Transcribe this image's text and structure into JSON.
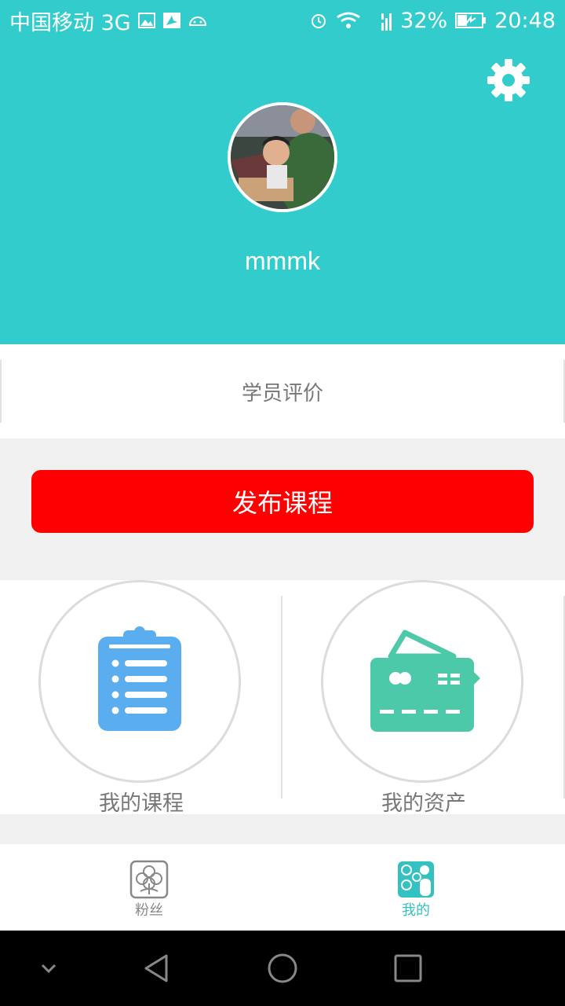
{
  "status_bar": {
    "carrier": "中国移动 3G",
    "battery": "32%",
    "time": "20:48"
  },
  "profile": {
    "username": "mmmk"
  },
  "review": {
    "label": "学员评价"
  },
  "publish": {
    "label": "发布课程"
  },
  "grid": [
    {
      "label": "我的课程",
      "icon": "clipboard-icon"
    },
    {
      "label": "我的资产",
      "icon": "wallet-card-icon"
    }
  ],
  "tabs": [
    {
      "label": "粉丝",
      "icon": "clover-icon",
      "active": false
    },
    {
      "label": "我的",
      "icon": "profile-gears-icon",
      "active": true
    }
  ],
  "colors": {
    "header": "#33cccc",
    "primary_button": "#ff0000",
    "clipboard": "#5aaef0",
    "wallet": "#4cc9a8",
    "tab_active": "#33c1c1",
    "tab_inactive": "#888888"
  }
}
